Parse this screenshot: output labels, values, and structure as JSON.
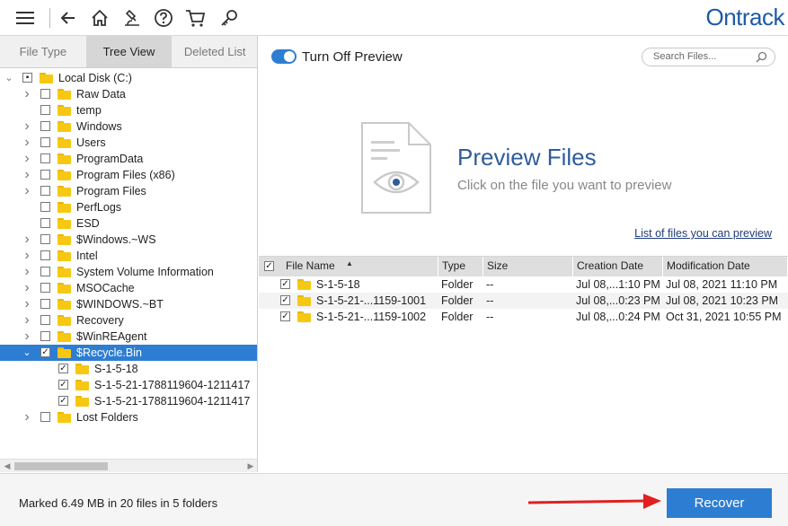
{
  "brand": "Ontrack",
  "toolbar": {
    "icons": [
      "menu-icon",
      "back-arrow-icon",
      "home-icon",
      "scan-microscope-icon",
      "help-icon",
      "cart-icon",
      "key-icon"
    ]
  },
  "left_tabs": [
    {
      "label": "File Type",
      "active": false
    },
    {
      "label": "Tree View",
      "active": true
    },
    {
      "label": "Deleted List",
      "active": false
    }
  ],
  "tree": [
    {
      "label": "Local Disk (C:)",
      "level": 0,
      "expanded": true,
      "check": "partial",
      "selected": false
    },
    {
      "label": "Raw Data",
      "level": 1,
      "expander": true,
      "check": "none",
      "selected": false
    },
    {
      "label": "temp",
      "level": 1,
      "expander": false,
      "check": "none",
      "selected": false
    },
    {
      "label": "Windows",
      "level": 1,
      "expander": true,
      "check": "none",
      "selected": false
    },
    {
      "label": "Users",
      "level": 1,
      "expander": true,
      "check": "none",
      "selected": false
    },
    {
      "label": "ProgramData",
      "level": 1,
      "expander": true,
      "check": "none",
      "selected": false
    },
    {
      "label": "Program Files (x86)",
      "level": 1,
      "expander": true,
      "check": "none",
      "selected": false
    },
    {
      "label": "Program Files",
      "level": 1,
      "expander": true,
      "check": "none",
      "selected": false
    },
    {
      "label": "PerfLogs",
      "level": 1,
      "expander": false,
      "check": "none",
      "selected": false
    },
    {
      "label": "ESD",
      "level": 1,
      "expander": false,
      "check": "none",
      "selected": false
    },
    {
      "label": "$Windows.~WS",
      "level": 1,
      "expander": true,
      "check": "none",
      "selected": false
    },
    {
      "label": "Intel",
      "level": 1,
      "expander": true,
      "check": "none",
      "selected": false
    },
    {
      "label": "System Volume Information",
      "level": 1,
      "expander": true,
      "check": "none",
      "selected": false
    },
    {
      "label": "MSOCache",
      "level": 1,
      "expander": true,
      "check": "none",
      "selected": false
    },
    {
      "label": "$WINDOWS.~BT",
      "level": 1,
      "expander": true,
      "check": "none",
      "selected": false
    },
    {
      "label": "Recovery",
      "level": 1,
      "expander": true,
      "check": "none",
      "selected": false
    },
    {
      "label": "$WinREAgent",
      "level": 1,
      "expander": true,
      "check": "none",
      "selected": false
    },
    {
      "label": "$Recycle.Bin",
      "level": 1,
      "expander": true,
      "expanded": true,
      "check": "checked",
      "selected": true
    },
    {
      "label": "S-1-5-18",
      "level": 2,
      "expander": false,
      "check": "checked",
      "selected": false
    },
    {
      "label": "S-1-5-21-1788119604-1211417",
      "level": 2,
      "expander": false,
      "check": "checked",
      "selected": false
    },
    {
      "label": "S-1-5-21-1788119604-1211417",
      "level": 2,
      "expander": false,
      "check": "checked",
      "selected": false
    },
    {
      "label": "Lost Folders",
      "level": 1,
      "expander": true,
      "check": "none",
      "selected": false
    }
  ],
  "preview": {
    "toggle_label": "Turn Off Preview",
    "toggle_on": true,
    "search_placeholder": "Search Files...",
    "title": "Preview Files",
    "subtitle": "Click on the file you want to preview",
    "link": "List of files you can preview"
  },
  "file_table": {
    "columns": [
      "File Name",
      "Type",
      "Size",
      "Creation Date",
      "Modification Date"
    ],
    "sorted_column": "File Name",
    "rows": [
      {
        "name": "S-1-5-18",
        "type": "Folder",
        "size": "--",
        "created": "Jul 08,...1:10 PM",
        "modified": "Jul 08, 2021 11:10 PM",
        "checked": true
      },
      {
        "name": "S-1-5-21-...1159-1001",
        "type": "Folder",
        "size": "--",
        "created": "Jul 08,...0:23 PM",
        "modified": "Jul 08, 2021 10:23 PM",
        "checked": true
      },
      {
        "name": "S-1-5-21-...1159-1002",
        "type": "Folder",
        "size": "--",
        "created": "Jul 08,...0:24 PM",
        "modified": "Oct 31, 2021 10:55 PM",
        "checked": true
      }
    ]
  },
  "status": {
    "text": "Marked 6.49 MB in 20 files in 5 folders"
  },
  "recover_label": "Recover",
  "colors": {
    "accent": "#2d7dd2",
    "brand": "#1e5aa8",
    "folder": "#f6c813",
    "arrow": "#e02020"
  }
}
